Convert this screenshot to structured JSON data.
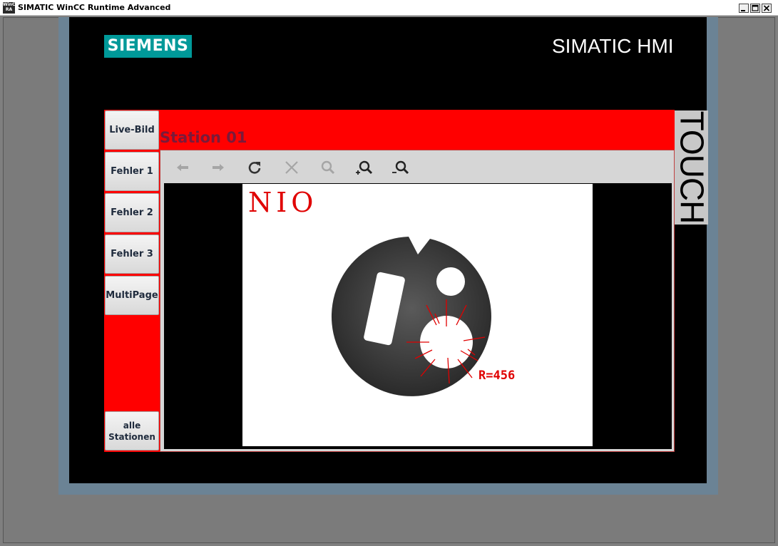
{
  "window": {
    "title": "SIMATIC WinCC Runtime Advanced",
    "icon_text": "WinCC RA"
  },
  "header": {
    "logo": "SIEMENS",
    "title": "SIMATIC HMI",
    "touch_label": "TOUCH"
  },
  "sidebar": {
    "items": [
      {
        "label": "Live-Bild"
      },
      {
        "label": "Fehler 1"
      },
      {
        "label": "Fehler 2"
      },
      {
        "label": "Fehler 3"
      },
      {
        "label": "MultiPage"
      },
      {
        "label": "alle Stationen"
      }
    ]
  },
  "panel": {
    "station_title": "Station 01"
  },
  "toolbar": {
    "buttons": [
      "back-icon",
      "forward-icon",
      "refresh-icon",
      "stop-icon",
      "search-icon",
      "zoom-in-icon",
      "zoom-out-icon"
    ]
  },
  "inspection": {
    "result": "NIO",
    "radius_label": "R=456"
  },
  "colors": {
    "accent_red": "#ff0000",
    "siemens_teal": "#009999",
    "bezel": "#6b8395",
    "title_text": "#7a1a3a"
  }
}
